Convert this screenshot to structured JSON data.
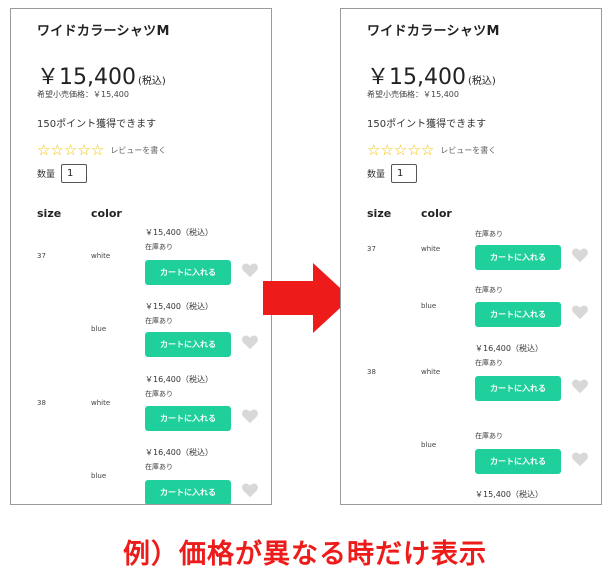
{
  "product": {
    "title": "ワイドカラーシャツM",
    "price": "￥15,400",
    "tax": "(税込)",
    "msrp": "希望小売価格：￥15,400",
    "points": "150ポイント獲得できます",
    "review": "レビューを書く",
    "qty_label": "数量",
    "qty_value": "1",
    "col_size": "size",
    "col_color": "color"
  },
  "cart_label": "カートに入れる",
  "left": {
    "rows": [
      {
        "size": "37",
        "color": "white",
        "price": "￥15,400（税込）",
        "stock": "在庫あり"
      },
      {
        "size": "",
        "color": "blue",
        "price": "￥15,400（税込）",
        "stock": "在庫あり"
      },
      {
        "size": "38",
        "color": "white",
        "price": "￥16,400（税込）",
        "stock": "在庫あり"
      },
      {
        "size": "",
        "color": "blue",
        "price": "￥16,400（税込）",
        "stock": "在庫あり"
      }
    ]
  },
  "right": {
    "rows": [
      {
        "size": "37",
        "color": "white",
        "stock": "在庫あり"
      },
      {
        "size": "",
        "color": "blue",
        "stock": "在庫あり"
      },
      {
        "size": "38",
        "color": "white",
        "price": "￥16,400（税込）",
        "stock": "在庫あり"
      },
      {
        "size": "",
        "color": "blue",
        "stock": "在庫あり"
      }
    ],
    "tail_price": "￥15,400（税込）"
  },
  "caption": "例）価格が異なる時だけ表示",
  "colors": {
    "accent": "#1fcf9c",
    "arrow": "#ee1b1b",
    "star": "#f2c200"
  },
  "icons": [
    "star-icon",
    "heart-icon",
    "right-arrow-icon"
  ]
}
